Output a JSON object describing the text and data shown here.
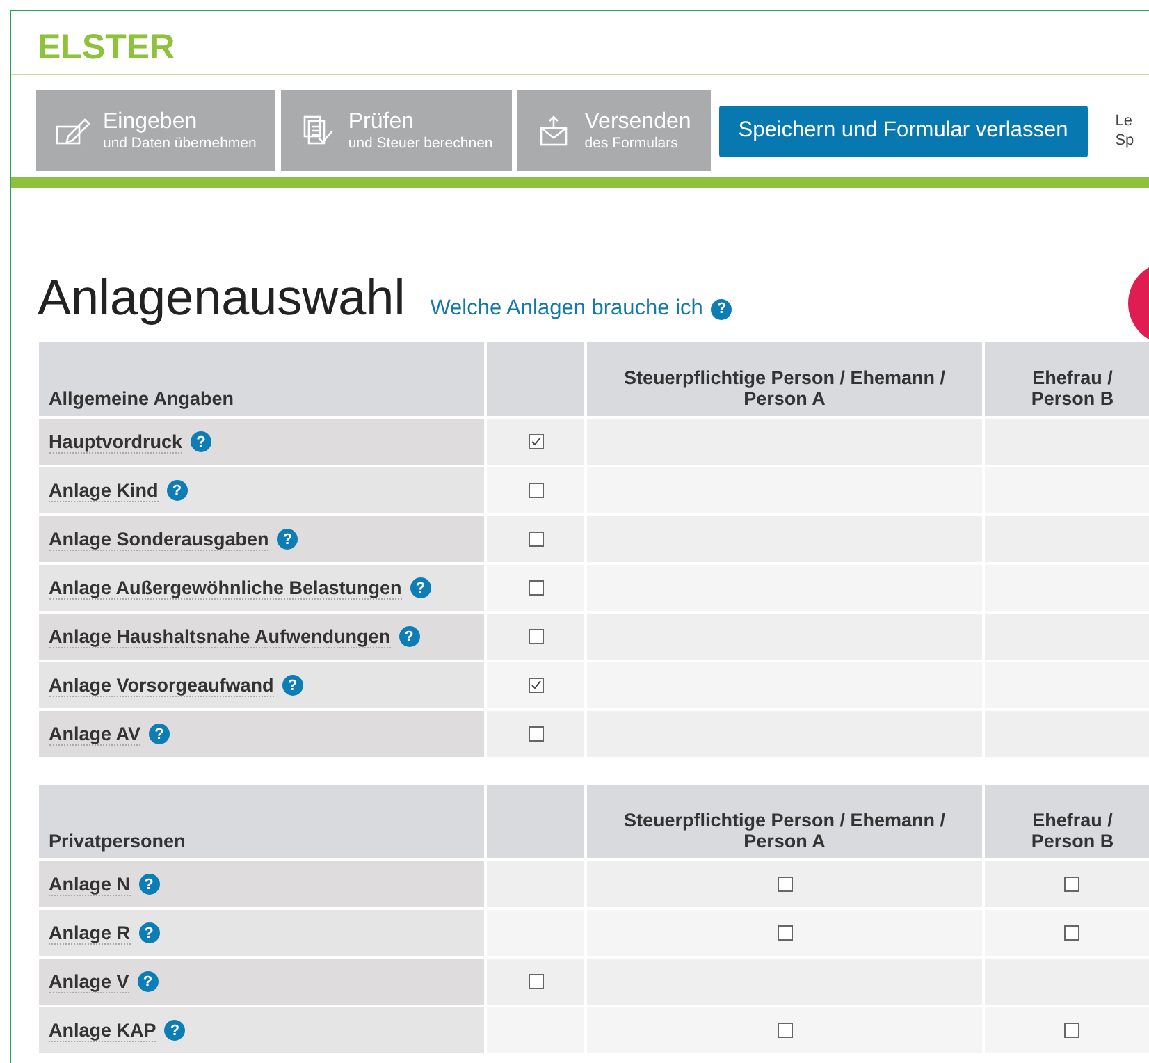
{
  "brand": "ELSTER",
  "toolbar": [
    {
      "kind": "edit",
      "title": "Eingeben",
      "subtitle": "und Daten übernehmen"
    },
    {
      "kind": "check",
      "title": "Prüfen",
      "subtitle": "und Steuer berechnen"
    },
    {
      "kind": "send",
      "title": "Versenden",
      "subtitle": "des Formulars"
    }
  ],
  "save_button": "Speichern und Formular verlassen",
  "side_text": [
    "Le",
    "Sp"
  ],
  "page_title": "Anlagenauswahl",
  "help_link": "Welche Anlagen brauche ich",
  "help_icon": "?",
  "sections": [
    {
      "columns": [
        "Allgemeine Angaben",
        "",
        "Steuerpflichtige Person / Ehemann / Person A",
        "Ehefrau / Person B"
      ],
      "rows": [
        {
          "label": "Hauptvordruck",
          "help": "?",
          "cells": [
            {
              "kind": "checkbox",
              "checked": true
            },
            {
              "kind": "empty"
            },
            {
              "kind": "empty"
            }
          ]
        },
        {
          "label": "Anlage Kind",
          "help": "?",
          "cells": [
            {
              "kind": "checkbox",
              "checked": false
            },
            {
              "kind": "empty"
            },
            {
              "kind": "empty"
            }
          ]
        },
        {
          "label": "Anlage Sonderausgaben",
          "help": "?",
          "cells": [
            {
              "kind": "checkbox",
              "checked": false
            },
            {
              "kind": "empty"
            },
            {
              "kind": "empty"
            }
          ]
        },
        {
          "label": "Anlage Außergewöhnliche Belastungen",
          "help": "?",
          "cells": [
            {
              "kind": "checkbox",
              "checked": false
            },
            {
              "kind": "empty"
            },
            {
              "kind": "empty"
            }
          ]
        },
        {
          "label": "Anlage Haushaltsnahe Aufwendungen",
          "help": "?",
          "cells": [
            {
              "kind": "checkbox",
              "checked": false
            },
            {
              "kind": "empty"
            },
            {
              "kind": "empty"
            }
          ]
        },
        {
          "label": "Anlage Vorsorgeaufwand",
          "help": "?",
          "cells": [
            {
              "kind": "checkbox",
              "checked": true
            },
            {
              "kind": "empty"
            },
            {
              "kind": "empty"
            }
          ]
        },
        {
          "label": "Anlage AV",
          "help": "?",
          "cells": [
            {
              "kind": "checkbox",
              "checked": false
            },
            {
              "kind": "empty"
            },
            {
              "kind": "empty"
            }
          ]
        }
      ]
    },
    {
      "columns": [
        "Privatpersonen",
        "",
        "Steuerpflichtige Person / Ehemann / Person A",
        "Ehefrau / Person B"
      ],
      "rows": [
        {
          "label": "Anlage N",
          "help": "?",
          "cells": [
            {
              "kind": "empty"
            },
            {
              "kind": "checkbox",
              "checked": false
            },
            {
              "kind": "checkbox",
              "checked": false
            }
          ]
        },
        {
          "label": "Anlage R",
          "help": "?",
          "cells": [
            {
              "kind": "empty"
            },
            {
              "kind": "checkbox",
              "checked": false
            },
            {
              "kind": "checkbox",
              "checked": false
            }
          ]
        },
        {
          "label": "Anlage V",
          "help": "?",
          "cells": [
            {
              "kind": "checkbox",
              "checked": false
            },
            {
              "kind": "empty"
            },
            {
              "kind": "empty"
            }
          ]
        },
        {
          "label": "Anlage KAP",
          "help": "?",
          "cells": [
            {
              "kind": "empty"
            },
            {
              "kind": "checkbox",
              "checked": false
            },
            {
              "kind": "checkbox",
              "checked": false
            }
          ]
        }
      ]
    }
  ]
}
